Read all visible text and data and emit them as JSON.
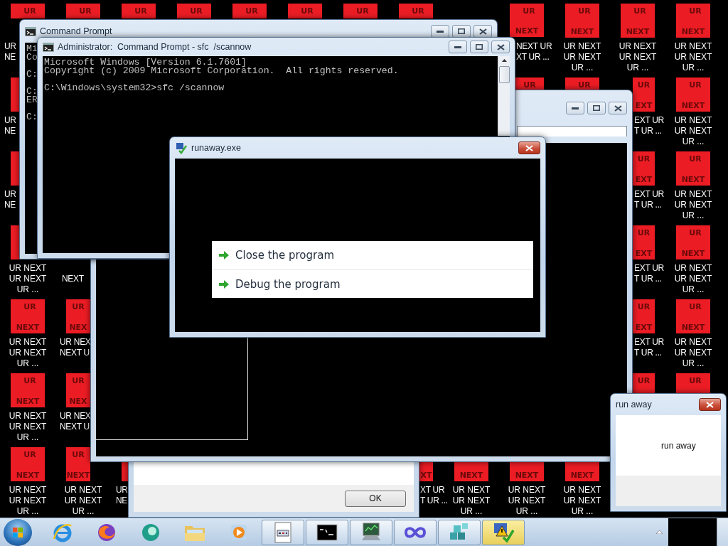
{
  "desktop": {
    "icons": [
      {
        "tile_top": "UR",
        "label": "UR\nNE"
      },
      {
        "tile_top": "UR"
      },
      {
        "tile_top": "UR"
      },
      {
        "tile_top": "UR"
      },
      {
        "tile_top": "UR"
      },
      {
        "tile_top": "UR"
      },
      {
        "tile_top": "UR"
      },
      {
        "tile_top": "UR"
      },
      {
        "tile_top": "UR",
        "tile_bottom": "NEXT",
        "label": "NEXT UR\nXT UR ..."
      },
      {
        "tile_top": "UR",
        "tile_bottom": "NEXT",
        "label": "UR NEXT UR NEXT UR ..."
      },
      {
        "tile_top": "UR",
        "tile_bottom": "NEXT",
        "label": "UR NEXT UR NEXT UR ..."
      },
      {
        "tile_top": "UR",
        "tile_bottom": "NEXT",
        "label": "UR NEXT UR NEXT UR ..."
      },
      {
        "label": "UR\nNE"
      },
      {
        "tile_top": "UR"
      },
      {
        "tile_top": "UR"
      },
      {
        "tile_top": "UR",
        "tile_bottom": "EXT",
        "label": "EXT UR\nT UR ..."
      },
      {
        "tile_top": "UR",
        "tile_bottom": "NEXT",
        "label": "UR NEXT UR NEXT UR ..."
      },
      {
        "label": "UR\nNE"
      },
      {
        "tile_top": "UR",
        "tile_bottom": "EXT",
        "label": "EXT UR\nT UR ..."
      },
      {
        "tile_top": "UR",
        "tile_bottom": "NEXT",
        "label": "UR NEXT UR NEXT UR ..."
      },
      {
        "label": "UR NEXT UR NEXT UR ..."
      },
      {
        "label": "NEXT"
      },
      {
        "tile_top": "UR",
        "tile_bottom": "EXT",
        "label": "EXT UR\nT UR ..."
      },
      {
        "tile_top": "UR",
        "tile_bottom": "NEXT",
        "label": "UR NEXT UR NEXT UR ..."
      },
      {
        "tile_top": "UR",
        "tile_bottom": "NEXT",
        "label": "UR NEXT UR NEXT UR ..."
      },
      {
        "tile_top": "UR",
        "tile_bottom": "NEX",
        "label": "UR NEX\nNEXT U"
      },
      {
        "tile_top": "UR",
        "tile_bottom": "EXT",
        "label": "EXT UR\nT UR ..."
      },
      {
        "tile_top": "UR",
        "tile_bottom": "NEXT",
        "label": "UR NEXT UR NEXT UR ..."
      },
      {
        "tile_top": "UR",
        "tile_bottom": "NEXT",
        "label": "UR NEXT UR NEXT UR ..."
      },
      {
        "tile_top": "UR",
        "tile_bottom": "NEX",
        "label": "UR NEX\nNEXT U"
      },
      {
        "tile_top": "UR"
      },
      {
        "tile_top": "UR"
      },
      {
        "tile_top": "UR",
        "tile_bottom": "NEXT",
        "label": "UR NEXT UR NEXT UR ..."
      },
      {
        "tile_top": "UR",
        "tile_bottom": "NEXT",
        "label": "UR NEXT UR NEXT UR ..."
      },
      {
        "label": "UR\nNE"
      },
      {
        "tile_bottom": "XT",
        "label": "XT UR\nT UR ..."
      },
      {
        "tile_bottom": "NEXT",
        "label": "UR NEXT UR NEXT UR ..."
      },
      {
        "tile_bottom": "NEXT",
        "label": "UR NEXT UR NEXT UR ..."
      },
      {
        "tile_bottom": "NEXT",
        "label": "UR NEXT UR NEXT UR ..."
      }
    ]
  },
  "windows": [
    {
      "kind": "form",
      "button": "OK"
    },
    {
      "kind": "panel",
      "active": false,
      "title_buttons": [
        {
          "kind": "minimize"
        },
        {
          "kind": "maximize"
        },
        {
          "kind": "close"
        }
      ]
    },
    {
      "kind": "console",
      "active": false,
      "title": "Command Prompt",
      "title_buttons": [
        {
          "kind": "minimize"
        },
        {
          "kind": "maximize"
        },
        {
          "kind": "close"
        }
      ],
      "text": "Mi\nCo\n\nC:\n\nC:\nER\n\nC:"
    },
    {
      "kind": "console",
      "active": false,
      "title": "Administrator:  Command Prompt - sfc  /scannow",
      "title_buttons": [
        {
          "kind": "minimize"
        },
        {
          "kind": "maximize"
        },
        {
          "kind": "close"
        }
      ],
      "text": "Microsoft Windows [Version 6.1.7601]\nCopyright (c) 2009 Microsoft Corporation.  All rights reserved.\n\nC:\\Windows\\system32>sfc /scannow"
    },
    {
      "kind": "crash",
      "active": true,
      "title": "runaway.exe",
      "title_buttons": [
        {
          "kind": "close"
        }
      ],
      "options": [
        {
          "label": "Close the program"
        },
        {
          "label": "Debug the program"
        }
      ]
    },
    {
      "kind": "message",
      "active": true,
      "title": "run away",
      "title_buttons": [
        {
          "kind": "close"
        }
      ],
      "text": "run away"
    }
  ],
  "taskbar": {
    "items": [
      {
        "kind": "pinned",
        "selected": false
      },
      {
        "kind": "pinned",
        "selected": false
      },
      {
        "kind": "pinned",
        "selected": false
      },
      {
        "kind": "pinned",
        "selected": false
      },
      {
        "kind": "pinned",
        "selected": false
      },
      {
        "kind": "open",
        "selected": false
      },
      {
        "kind": "open",
        "selected": false
      },
      {
        "kind": "open",
        "selected": false
      },
      {
        "kind": "open",
        "selected": false
      },
      {
        "kind": "open",
        "selected": false
      },
      {
        "kind": "open",
        "selected": true
      }
    ]
  }
}
